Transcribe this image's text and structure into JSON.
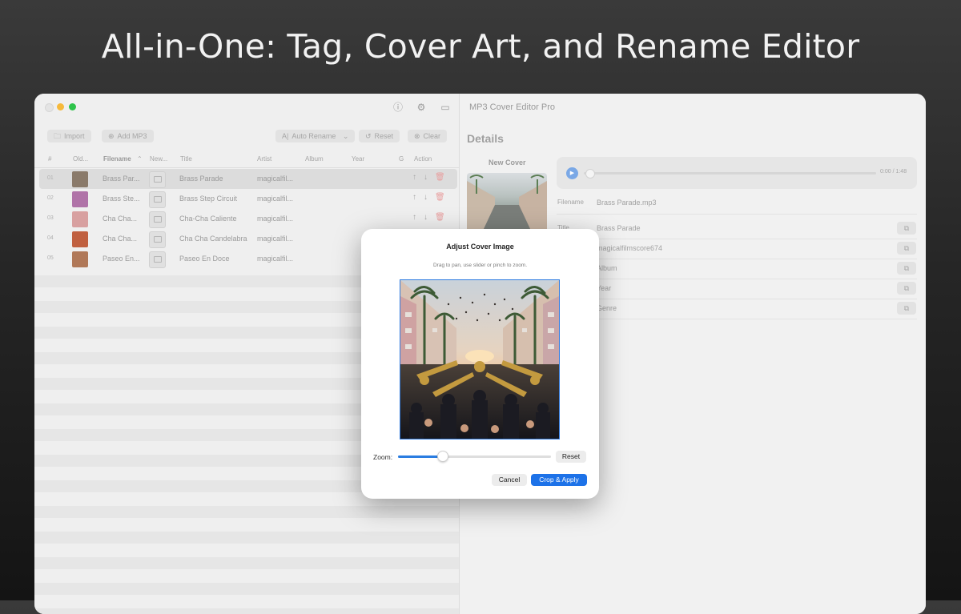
{
  "headline": "All-in-One: Tag, Cover Art, and Rename Editor",
  "window": {
    "title": "MP3 Cover Editor Pro"
  },
  "toolbar": {
    "import_label": "Import",
    "add_mp3_label": "Add MP3",
    "auto_rename_label": "Auto Rename",
    "reset_label": "Reset",
    "clear_label": "Clear"
  },
  "table": {
    "columns": [
      "#",
      "Old...",
      "Filename",
      "New...",
      "Title",
      "Artist",
      "Album",
      "Year",
      "G",
      "Action"
    ],
    "rows": [
      {
        "num": "01",
        "filename": "Brass Par...",
        "title": "Brass Parade",
        "artist": "magicalfil...",
        "selected": true,
        "thumb": "#8a7a6a"
      },
      {
        "num": "02",
        "filename": "Brass Ste...",
        "title": "Brass Step Circuit",
        "artist": "magicalfil...",
        "selected": false,
        "thumb": "#b073a8"
      },
      {
        "num": "03",
        "filename": "Cha Cha...",
        "title": "Cha-Cha Caliente",
        "artist": "magicalfil...",
        "selected": false,
        "thumb": "#d8a0a0"
      },
      {
        "num": "04",
        "filename": "Cha Cha...",
        "title": "Cha Cha Candelabra",
        "artist": "magicalfil...",
        "selected": false,
        "thumb": "#c06040"
      },
      {
        "num": "05",
        "filename": "Paseo En...",
        "title": "Paseo En Doce",
        "artist": "magicalfil...",
        "selected": false,
        "thumb": "#b07858"
      }
    ]
  },
  "details": {
    "heading": "Details",
    "new_cover_label": "New Cover",
    "time": "0:00 / 1:48",
    "filename_label": "Filename",
    "filename_value": "Brass Parade.mp3",
    "fields": [
      {
        "label": "Title",
        "value": "Brass Parade"
      },
      {
        "label": "Artist",
        "value": "magicalfilmscore674"
      },
      {
        "label": "Album",
        "value": "Album"
      },
      {
        "label": "Year",
        "value": "Year"
      },
      {
        "label": "Genre",
        "value": "Genre"
      }
    ]
  },
  "dialog": {
    "title": "Adjust Cover Image",
    "subtitle": "Drag to pan, use slider or pinch to zoom.",
    "zoom_label": "Zoom:",
    "zoom_fraction": 0.29,
    "reset_label": "Reset",
    "cancel_label": "Cancel",
    "apply_label": "Crop & Apply"
  },
  "colors": {
    "accent": "#1d72e8",
    "close": "#ececec",
    "minimize": "#f6b93b",
    "zoom": "#2ec34a"
  }
}
